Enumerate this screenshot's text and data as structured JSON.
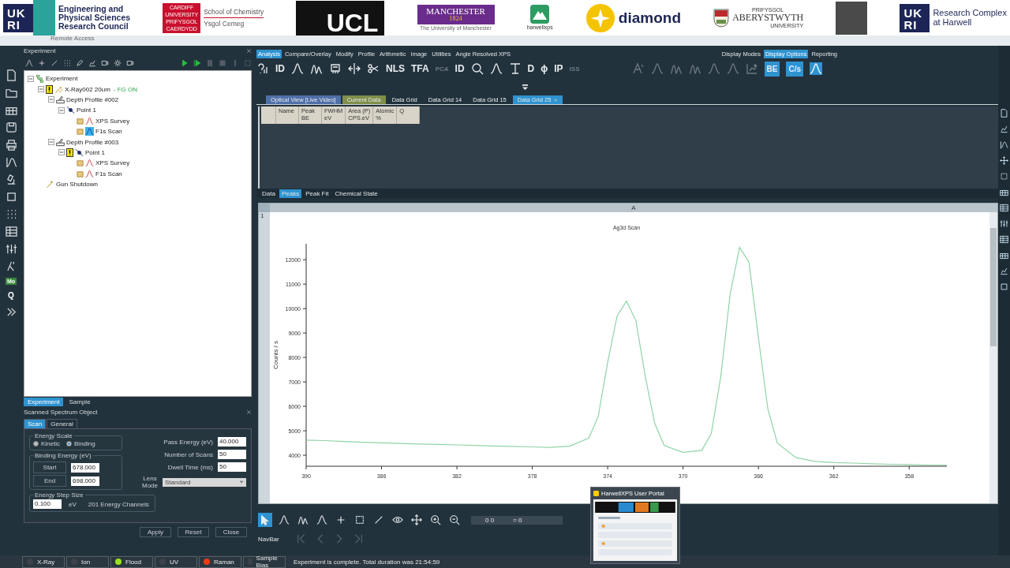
{
  "banner": {
    "logos": [
      {
        "kind": "ukri-council",
        "mark": [
          "UK",
          "RI"
        ],
        "caption": [
          "Engineering and",
          "Physical Sciences",
          "Research Council"
        ]
      },
      {
        "kind": "red-block",
        "mark": [
          "CARDIFF",
          "UNIVERSITY",
          "PRIFYSGOL",
          "CAERDYDD"
        ],
        "caption": [
          "School of Chemistry",
          "Ysgol Cemeg"
        ]
      },
      {
        "kind": "black-block",
        "mark": [
          "UCL"
        ]
      },
      {
        "kind": "purple-block",
        "mark": [
          "MANCHESTER",
          "1824"
        ],
        "caption": [
          "The University of Manchester"
        ]
      },
      {
        "kind": "mountain",
        "caption": [
          "harwellxps"
        ]
      },
      {
        "kind": "sun",
        "caption": [
          "diamond"
        ]
      },
      {
        "kind": "crest",
        "caption": [
          "PRIFYSGOL",
          "ABERYSTWYTH",
          "UNIVERSITY"
        ]
      },
      {
        "kind": "grey-block"
      },
      {
        "kind": "ukri",
        "mark": [
          "UK",
          "RI"
        ],
        "caption": [
          "Research Complex",
          "at Harwell"
        ]
      }
    ],
    "underlay": "Remote Access"
  },
  "side_strip": {
    "labels": [
      "Mo",
      "Q"
    ]
  },
  "experiment_panel": {
    "title": "Experiment",
    "tree": [
      {
        "label": "Experiment",
        "kind": "experiment",
        "selected": false,
        "expanded": true,
        "children": [
          {
            "label": "X-Ray002 20um",
            "status": "- FG  ON",
            "kind": "laser",
            "warning": true,
            "selected": false,
            "expanded": true,
            "children": [
              {
                "label": "Depth Profile #002",
                "kind": "sample",
                "selected": false,
                "expanded": true,
                "children": [
                  {
                    "label": "Point 1",
                    "kind": "point",
                    "selected": false,
                    "expanded": true,
                    "children": [
                      {
                        "label": "XPS Survey",
                        "kind": "spectrum",
                        "selected": false
                      },
                      {
                        "label": "F1s Scan",
                        "kind": "spectrum",
                        "selected": true
                      }
                    ]
                  }
                ]
              },
              {
                "label": "Depth Profile #003",
                "kind": "sample",
                "selected": false,
                "expanded": true,
                "children": [
                  {
                    "label": "Point 1",
                    "kind": "point",
                    "warning": true,
                    "selected": false,
                    "expanded": true,
                    "children": [
                      {
                        "label": "XPS Survey",
                        "kind": "spectrum",
                        "selected": false
                      },
                      {
                        "label": "F1s Scan",
                        "kind": "spectrum",
                        "selected": false
                      }
                    ]
                  }
                ]
              }
            ]
          },
          {
            "label": "Gun Shutdown",
            "kind": "wand",
            "selected": false
          }
        ]
      }
    ],
    "tabs": [
      {
        "label": "Experiment",
        "selected": true
      },
      {
        "label": "Sample",
        "selected": false
      }
    ]
  },
  "spectrum_panel": {
    "title": "Scanned Spectrum Object",
    "tabs": [
      {
        "label": "Scan",
        "selected": true
      },
      {
        "label": "General",
        "selected": false
      }
    ],
    "energy_scale": {
      "title": "Energy Scale",
      "options": [
        {
          "label": "Kinetic",
          "selected": false
        },
        {
          "label": "Binding",
          "selected": true
        }
      ]
    },
    "binding_energy": {
      "title": "Binding Energy (eV)",
      "rows": [
        {
          "label": "Start",
          "value": "678.000"
        },
        {
          "label": "End",
          "value": "698.000"
        }
      ]
    },
    "fields": [
      {
        "label": "Pass Energy (eV)",
        "value": "40.000"
      },
      {
        "label": "Number of Scans",
        "value": "50"
      },
      {
        "label": "Dwell Time  (ms)",
        "value": "50"
      }
    ],
    "lens_mode": {
      "label": "Lens\nMode",
      "value": "Standard"
    },
    "step": {
      "title": "Energy Step Size",
      "value": "0.100",
      "unit": "eV",
      "channels": "201 Energy Channels"
    },
    "buttons": [
      "Apply",
      "Reset",
      "Close"
    ]
  },
  "ribbon": {
    "tabs": [
      {
        "label": "Analysis",
        "selected": true
      },
      {
        "label": "Compare/Overlay",
        "selected": false
      },
      {
        "label": "Modify",
        "selected": false
      },
      {
        "label": "Profile",
        "selected": false
      },
      {
        "label": "Arithmetic",
        "selected": false
      },
      {
        "label": "Image",
        "selected": false
      },
      {
        "label": "Utilities",
        "selected": false
      },
      {
        "label": "Angle Resolved XPS",
        "selected": false
      }
    ],
    "right_tabs": [
      {
        "label": "Display Modes",
        "selected": false
      },
      {
        "label": "Display Options",
        "selected": true
      },
      {
        "label": "Reporting",
        "selected": false
      }
    ],
    "tools": [
      {
        "kind": "help",
        "disabled": false
      },
      {
        "kind": "text",
        "label": "ID",
        "disabled": false
      },
      {
        "kind": "peak",
        "disabled": false
      },
      {
        "kind": "peaks",
        "disabled": false
      },
      {
        "kind": "chip",
        "disabled": false
      },
      {
        "kind": "split",
        "disabled": false
      },
      {
        "kind": "cut",
        "disabled": false
      },
      {
        "kind": "text",
        "label": "NLS",
        "disabled": false
      },
      {
        "kind": "text",
        "label": "TFA",
        "disabled": false
      },
      {
        "kind": "text",
        "label": "PCA",
        "disabled": true
      },
      {
        "kind": "text",
        "label": "ID",
        "disabled": false
      },
      {
        "kind": "search",
        "disabled": false
      },
      {
        "kind": "peak",
        "disabled": false
      },
      {
        "kind": "bracket",
        "disabled": false
      },
      {
        "kind": "text",
        "label": "D",
        "disabled": false
      },
      {
        "kind": "text",
        "label": "ϕ",
        "disabled": false
      },
      {
        "kind": "text",
        "label": "IP",
        "disabled": false
      },
      {
        "kind": "text",
        "label": "ISS",
        "disabled": true
      }
    ],
    "right_tools": [
      {
        "kind": "letter",
        "selected": false
      },
      {
        "kind": "peak",
        "selected": false
      },
      {
        "kind": "peaks",
        "selected": false
      },
      {
        "kind": "peaks",
        "selected": false
      },
      {
        "kind": "peak",
        "selected": false
      },
      {
        "kind": "peak",
        "selected": false
      },
      {
        "kind": "chartadd",
        "selected": false
      },
      {
        "kind": "text",
        "label": "BE",
        "selected": true
      },
      {
        "kind": "text",
        "label": "C/s",
        "selected": true
      },
      {
        "kind": "peak",
        "selected": true
      }
    ]
  },
  "doc_tabs": [
    {
      "label": "Optical View [Live Video]",
      "selected": false,
      "color": "#4f6fa8"
    },
    {
      "label": "Current Data",
      "selected": false,
      "color": "#7f8f4a"
    },
    {
      "label": "Data Grid",
      "selected": false
    },
    {
      "label": "Data Grid 14",
      "selected": false
    },
    {
      "label": "Data Grid 15",
      "selected": false
    },
    {
      "label": "Data Grid 25",
      "selected": true
    }
  ],
  "peaks_table": {
    "columns": [
      "Name",
      "Peak\nBE",
      "FWHM\neV",
      "Area (P)\nCPS.eV",
      "Atomic\n%",
      "Q"
    ]
  },
  "data_tabs": [
    {
      "label": "Data",
      "selected": false
    },
    {
      "label": "Peaks",
      "selected": true
    },
    {
      "label": "Peak Fit",
      "selected": false
    },
    {
      "label": "Chemical State",
      "selected": false
    }
  ],
  "chart_panel": {
    "column": "A",
    "row": "1",
    "chart_data": {
      "type": "line",
      "title": "Ag3d Scan",
      "ylabel": "Counts / s",
      "x": [
        390,
        389,
        388,
        387,
        386,
        385,
        384,
        383,
        382,
        381,
        380,
        379,
        378,
        377,
        376,
        375,
        374.5,
        374,
        373.5,
        373,
        372.5,
        372,
        371.5,
        371,
        370,
        369,
        368.5,
        368,
        367.5,
        367,
        366.5,
        366,
        365.5,
        365,
        364,
        363,
        362,
        361,
        360,
        359,
        358,
        357,
        356
      ],
      "series": [
        {
          "color": "#8fd4a4",
          "values": [
            4620,
            4600,
            4560,
            4530,
            4510,
            4480,
            4460,
            4440,
            4420,
            4400,
            4380,
            4360,
            4340,
            4320,
            4380,
            4700,
            5600,
            7800,
            9700,
            10300,
            9500,
            7200,
            5300,
            4400,
            4120,
            4200,
            4900,
            7200,
            10600,
            12500,
            11900,
            8800,
            5900,
            4500,
            3900,
            3750,
            3700,
            3680,
            3650,
            3630,
            3620,
            3600,
            3600
          ]
        }
      ],
      "xlim": [
        390,
        356
      ],
      "ylim": [
        3550,
        12650
      ],
      "xticks": [
        390,
        386,
        382,
        378,
        374,
        370,
        366,
        362,
        358
      ],
      "yticks": [
        4000,
        5000,
        6000,
        7000,
        8000,
        9000,
        10000,
        11000,
        12000
      ]
    }
  },
  "bottom_toolbar": {
    "tools": [
      {
        "kind": "cursor",
        "selected": true
      },
      {
        "kind": "peak",
        "selected": false
      },
      {
        "kind": "peaks",
        "selected": false
      },
      {
        "kind": "peak",
        "selected": false
      },
      {
        "kind": "plus",
        "selected": false
      },
      {
        "kind": "square",
        "selected": false
      },
      {
        "kind": "line",
        "selected": false
      },
      {
        "kind": "eye",
        "selected": false
      },
      {
        "kind": "move",
        "selected": false
      },
      {
        "kind": "zoomin",
        "selected": false
      },
      {
        "kind": "zoomout",
        "selected": false
      }
    ],
    "readout": [
      "0  0",
      "= 0"
    ],
    "navbar": "NavBar"
  },
  "popup": {
    "title": "HarwellXPS User Portal"
  },
  "status_bar": {
    "indicators": [
      {
        "label": "X-Ray",
        "color": "#3d434b"
      },
      {
        "label": "Ion",
        "color": "#3d434b"
      },
      {
        "label": "Flood",
        "color": "#9be31c"
      },
      {
        "label": "UV",
        "color": "#3d434b"
      },
      {
        "label": "Raman",
        "color": "#f03a12"
      },
      {
        "label": "Sample Bias",
        "color": "#3d434b"
      }
    ],
    "message": "Experiment is complete. Total duration was 21:54:59"
  }
}
